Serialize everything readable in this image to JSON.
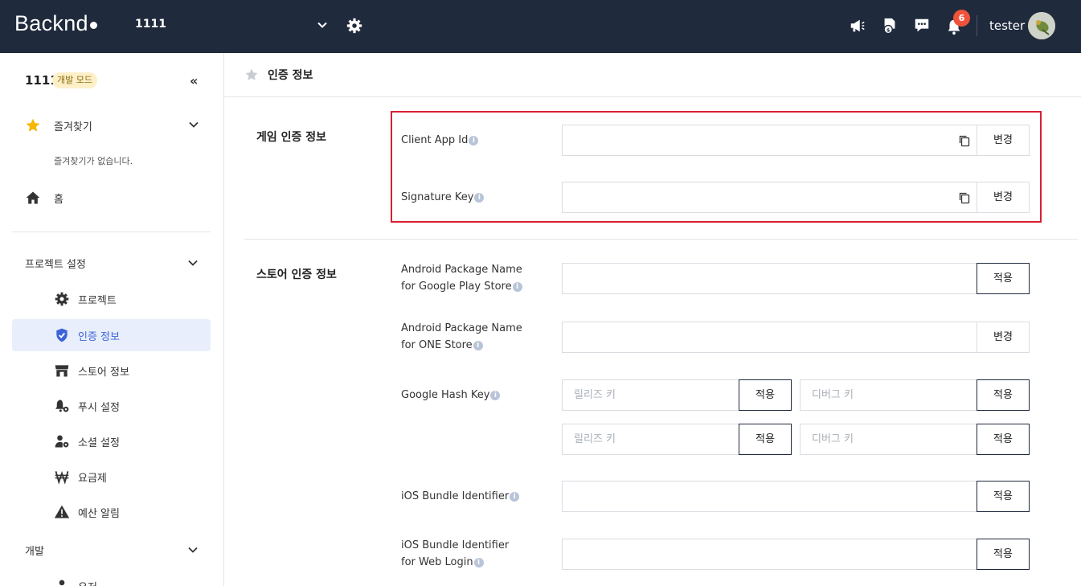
{
  "topbar": {
    "logo": "Backnd",
    "project": "1111",
    "notification_count": "6",
    "username": "tester",
    "icons": [
      "chevron-down-icon",
      "gear-icon",
      "megaphone-icon",
      "document-coin-icon",
      "chat-icon",
      "bell-icon"
    ]
  },
  "sidebar": {
    "project_name": "1111",
    "mode_badge": "개발 모드",
    "collapse": "«",
    "favorites": {
      "label": "즐겨찾기",
      "empty": "즐겨찾기가 없습니다."
    },
    "home": "홈",
    "project_settings": {
      "label": "프로젝트 설정",
      "items": [
        {
          "label": "프로젝트",
          "icon": "gear-icon"
        },
        {
          "label": "인증 정보",
          "icon": "shield-check-icon",
          "active": true
        },
        {
          "label": "스토어 정보",
          "icon": "store-icon"
        },
        {
          "label": "푸시 설정",
          "icon": "bell-gear-icon"
        },
        {
          "label": "소셜 설정",
          "icon": "user-gear-icon"
        },
        {
          "label": "요금제",
          "icon": "won-icon"
        },
        {
          "label": "예산 알림",
          "icon": "warning-icon"
        }
      ]
    },
    "dev": {
      "label": "개발",
      "items": [
        {
          "label": "유저"
        }
      ]
    }
  },
  "main": {
    "title": "인증 정보",
    "game_auth": {
      "title": "게임 인증 정보",
      "client_app_id": {
        "label": "Client App Id",
        "value": "",
        "button": "변경"
      },
      "signature_key": {
        "label": "Signature Key",
        "value": "",
        "button": "변경"
      }
    },
    "store_auth": {
      "title": "스토어 인증 정보",
      "android_google": {
        "label_1": "Android Package Name",
        "label_2": "for Google Play Store",
        "value": "",
        "button": "적용"
      },
      "android_one": {
        "label_1": "Android Package Name",
        "label_2": "for ONE Store",
        "value": "",
        "button": "변경"
      },
      "google_hash": {
        "label": "Google Hash Key",
        "release_placeholder": "릴리즈 키",
        "debug_placeholder": "디버그 키",
        "button": "적용"
      },
      "ios_bundle": {
        "label": "iOS Bundle Identifier",
        "value": "",
        "button": "적용"
      },
      "ios_web": {
        "label_1": "iOS Bundle Identifier",
        "label_2": "for Web Login",
        "value": "",
        "button": "적용"
      }
    }
  },
  "colors": {
    "topbar": "#1f2a3c",
    "accent": "#3d63d9",
    "badge": "#f0533b",
    "highlight": "#d92032",
    "star": "#f5b700"
  }
}
